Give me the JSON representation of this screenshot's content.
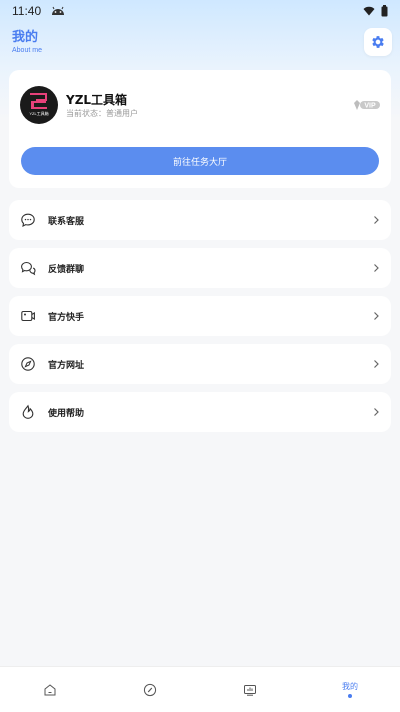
{
  "status_bar": {
    "time": "11:40"
  },
  "header": {
    "title": "我的",
    "subtitle": "About me"
  },
  "profile": {
    "avatar_text": "YZL工具箱",
    "name": "YZL工具箱",
    "status": "当前状态：普通用户",
    "badge": "VIP"
  },
  "task_button": {
    "label": "前往任务大厅"
  },
  "menu": [
    {
      "label": "联系客服",
      "icon": "chat-bubble-icon"
    },
    {
      "label": "反馈群聊",
      "icon": "group-chat-icon"
    },
    {
      "label": "官方快手",
      "icon": "video-icon"
    },
    {
      "label": "官方网址",
      "icon": "compass-icon"
    },
    {
      "label": "使用帮助",
      "icon": "help-drop-icon"
    }
  ],
  "bottom_nav": {
    "active_label": "我的",
    "items": [
      {
        "icon": "home-icon"
      },
      {
        "icon": "compass-icon"
      },
      {
        "icon": "chart-board-icon"
      },
      {
        "icon": "profile"
      }
    ]
  },
  "colors": {
    "accent": "#4a7df0",
    "button": "#5b8def",
    "background": "#f6f7f9",
    "card": "#ffffff"
  }
}
